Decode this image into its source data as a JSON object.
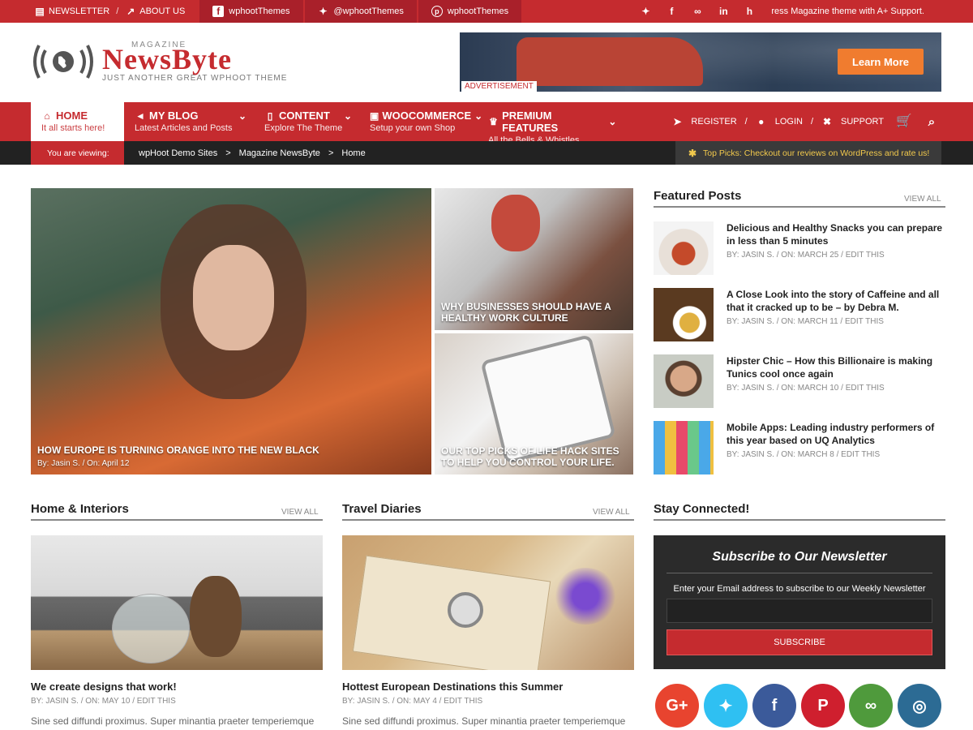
{
  "topbar": {
    "newsletter": "NEWSLETTER",
    "about": "ABOUT US",
    "facebook": "wphootThemes",
    "twitter": "@wphootThemes",
    "pinterest": "wphootThemes",
    "ticker": "ress Magazine theme with A+ Support."
  },
  "header": {
    "logo_small": "MAGAZINE",
    "logo_name": "NewsByte",
    "tagline": "JUST ANOTHER GREAT WPHOOT THEME",
    "ad_label": "ADVERTISEMENT",
    "ad_button": "Learn More"
  },
  "nav": {
    "items": [
      {
        "label": "HOME",
        "sub": "It all starts here!"
      },
      {
        "label": "MY BLOG",
        "sub": "Latest Articles and Posts"
      },
      {
        "label": "CONTENT",
        "sub": "Explore The Theme"
      },
      {
        "label": "WOOCOMMERCE",
        "sub": "Setup your own Shop"
      },
      {
        "label": "PREMIUM FEATURES",
        "sub": "All the Bells & Whistles"
      }
    ],
    "register": "REGISTER",
    "login": "LOGIN",
    "support": "SUPPORT"
  },
  "crumb": {
    "viewing": "You are viewing:",
    "trail": [
      "wpHoot Demo Sites",
      "Magazine NewsByte",
      "Home"
    ],
    "picks": "Top Picks: Checkout our reviews on WordPress and rate us!"
  },
  "hero": {
    "main_title": "HOW EUROPE IS TURNING ORANGE INTO THE NEW BLACK",
    "main_meta": "By:  Jasin S.  /  On:  April 12",
    "top_title": "WHY BUSINESSES SHOULD HAVE A HEALTHY WORK CULTURE",
    "bottom_title": "OUR TOP PICKS OF LIFE HACK SITES TO HELP YOU CONTROL YOUR LIFE."
  },
  "featured": {
    "title": "Featured Posts",
    "view_all": "VIEW ALL",
    "posts": [
      {
        "title": "Delicious and Healthy Snacks you can prepare in less than 5 minutes",
        "meta": "BY:  JASIN S.  /  ON:  MARCH 25  /  EDIT THIS"
      },
      {
        "title": "A Close Look into the story of Caffeine and all that it cracked up to be – by Debra M.",
        "meta": "BY:  JASIN S.  /  ON:  MARCH 11  /  EDIT THIS"
      },
      {
        "title": "Hipster Chic – How this Billionaire is making Tunics cool once again",
        "meta": "BY:  JASIN S.  /  ON:  MARCH 10  /  EDIT THIS"
      },
      {
        "title": "Mobile Apps: Leading industry performers of this year based on UQ Analytics",
        "meta": "BY:  JASIN S.  /  ON:  MARCH 8  /  EDIT THIS"
      }
    ]
  },
  "sections": [
    {
      "title": "Home & Interiors",
      "view_all": "VIEW ALL",
      "post_title": "We create designs that work!",
      "meta": "BY:  JASIN S.  /  ON:  MAY 10  /  EDIT THIS",
      "excerpt": "Sine sed diffundi proximus. Super minantia praeter temperiemque"
    },
    {
      "title": "Travel Diaries",
      "view_all": "VIEW ALL",
      "post_title": "Hottest European Destinations this Summer",
      "meta": "BY:  JASIN S.  /  ON:  MAY 4  /  EDIT THIS",
      "excerpt": "Sine sed diffundi proximus. Super minantia praeter temperiemque"
    }
  ],
  "connected": {
    "title": "Stay Connected!",
    "newsletter_title": "Subscribe to Our Newsletter",
    "newsletter_text": "Enter your Email address to subscribe to our Weekly Newsletter",
    "email_placeholder": "",
    "subscribe": "SUBSCRIBE",
    "icons": [
      "google-plus-icon",
      "twitter-icon",
      "facebook-icon",
      "pinterest-icon",
      "tripadvisor-icon",
      "instagram-icon"
    ],
    "colors": [
      "#e8442f",
      "#2fc0f2",
      "#3b5a9a",
      "#cf1f2e",
      "#4f9a3c",
      "#2c6b94"
    ]
  },
  "colors": {
    "accent": "#c52b2f",
    "dark": "#222222",
    "ad_button": "#f07c2f",
    "picks": "#f2c94c"
  }
}
